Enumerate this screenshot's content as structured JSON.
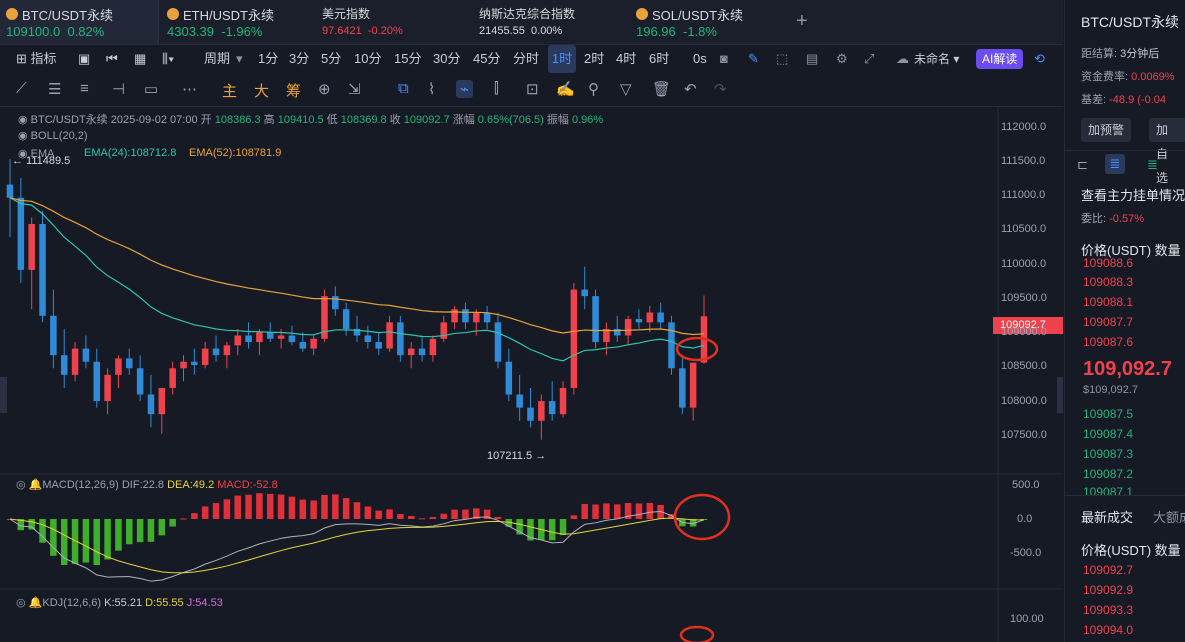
{
  "tabs": [
    {
      "name": "BTC/USDT永续",
      "price": "109100.0",
      "change": "0.82%",
      "dir": "up"
    },
    {
      "name": "ETH/USDT永续",
      "price": "4303.39",
      "change": "-1.96%",
      "dir": "up"
    },
    {
      "name": "美元指数",
      "price": "97.6421",
      "change": "-0.20%",
      "dir": "dn"
    },
    {
      "name": "纳斯达克综合指数",
      "price": "21455.55",
      "change": "0.00%",
      "dir": "neutral"
    },
    {
      "name": "SOL/USDT永续",
      "price": "196.96",
      "change": "-1.8%",
      "dir": "up"
    }
  ],
  "toolbar": {
    "indicator": "指标",
    "period": "周期",
    "intervals": [
      "1分",
      "3分",
      "5分",
      "10分",
      "15分",
      "30分",
      "45分",
      "分时",
      "1时",
      "2时",
      "4时",
      "6时",
      "0s"
    ],
    "selected_interval": "1时",
    "unnamed": "未命名",
    "ai": "AI解读"
  },
  "draw_tools": {
    "main": "主",
    "big": "大",
    "fund": "筹"
  },
  "chart": {
    "symbol": "BTC/USDT永续",
    "datetime": "2025-09-02 07:00",
    "open_label": "开",
    "open": "108386.3",
    "high_label": "高",
    "high": "109410.5",
    "low_label": "低",
    "low": "108369.8",
    "close_label": "收",
    "close": "109092.7",
    "change_label": "涨幅",
    "change": "0.65%(706.5)",
    "amp_label": "振幅",
    "amp": "0.96%",
    "boll": "BOLL(20,2)",
    "ema_label": "EMA",
    "ema24": "EMA(24):108712.8",
    "ema52": "EMA(52):108781.9",
    "high_mark": "← 111489.5",
    "low_mark": "107211.5 →",
    "price_tag": "109092.7",
    "y_ticks": [
      "112000.0",
      "111500.0",
      "111000.0",
      "110500.0",
      "110000.0",
      "109500.0",
      "109000.0",
      "108500.0",
      "108000.0",
      "107500.0"
    ],
    "macd": {
      "label": "MACD(12,26,9)",
      "dif": "DIF:22.8",
      "dea": "DEA:49.2",
      "macd": "MACD:-52.8",
      "ticks": [
        "500.0",
        "0.0",
        "-500.0"
      ]
    },
    "kdj": {
      "label": "KDJ(12,6,6)",
      "k": "K:55.21",
      "d": "D:55.55",
      "j": "J:54.53",
      "ticks": [
        "100.00"
      ]
    }
  },
  "chart_data": {
    "type": "candlestick",
    "interval": "1h",
    "ylim": [
      107100,
      112100
    ],
    "candles": [
      [
        111100,
        111489,
        110300,
        110900
      ],
      [
        110900,
        111200,
        109600,
        109800
      ],
      [
        109800,
        110600,
        109200,
        110500
      ],
      [
        110500,
        110700,
        109000,
        109100
      ],
      [
        109100,
        109500,
        108300,
        108500
      ],
      [
        108500,
        108900,
        108000,
        108200
      ],
      [
        108200,
        108700,
        108100,
        108600
      ],
      [
        108600,
        108800,
        108300,
        108400
      ],
      [
        108400,
        108600,
        107700,
        107800
      ],
      [
        107800,
        108300,
        107600,
        108200
      ],
      [
        108200,
        108500,
        108000,
        108450
      ],
      [
        108450,
        108600,
        108200,
        108300
      ],
      [
        108300,
        108500,
        107800,
        107900
      ],
      [
        107900,
        108200,
        107400,
        107600
      ],
      [
        107600,
        108000,
        107300,
        108000
      ],
      [
        108000,
        108400,
        107900,
        108300
      ],
      [
        108300,
        108500,
        108100,
        108400
      ],
      [
        108400,
        108600,
        108200,
        108350
      ],
      [
        108350,
        108700,
        108300,
        108600
      ],
      [
        108600,
        108800,
        108400,
        108500
      ],
      [
        108500,
        108700,
        108300,
        108650
      ],
      [
        108650,
        108900,
        108500,
        108800
      ],
      [
        108800,
        109000,
        108600,
        108700
      ],
      [
        108700,
        108900,
        108500,
        108850
      ],
      [
        108850,
        109000,
        108700,
        108750
      ],
      [
        108750,
        108900,
        108600,
        108800
      ],
      [
        108800,
        108950,
        108650,
        108700
      ],
      [
        108700,
        108850,
        108550,
        108600
      ],
      [
        108600,
        108800,
        108500,
        108750
      ],
      [
        108750,
        109500,
        108700,
        109400
      ],
      [
        109400,
        109550,
        109100,
        109200
      ],
      [
        109200,
        109300,
        108800,
        108900
      ],
      [
        108900,
        109100,
        108700,
        108800
      ],
      [
        108800,
        108950,
        108600,
        108700
      ],
      [
        108700,
        108850,
        108500,
        108600
      ],
      [
        108600,
        109100,
        108550,
        109000
      ],
      [
        109000,
        109100,
        108400,
        108500
      ],
      [
        108500,
        108700,
        108300,
        108600
      ],
      [
        108600,
        108800,
        108400,
        108500
      ],
      [
        108500,
        108800,
        108400,
        108750
      ],
      [
        108750,
        109100,
        108700,
        109000
      ],
      [
        109000,
        109250,
        108900,
        109200
      ],
      [
        109200,
        109300,
        108900,
        109000
      ],
      [
        109000,
        109200,
        108800,
        109150
      ],
      [
        109150,
        109250,
        108900,
        109000
      ],
      [
        109000,
        109150,
        108300,
        108400
      ],
      [
        108400,
        108600,
        107800,
        107900
      ],
      [
        107900,
        108200,
        107500,
        107700
      ],
      [
        107700,
        108000,
        107400,
        107500
      ],
      [
        107500,
        107900,
        107211,
        107800
      ],
      [
        107800,
        108100,
        107500,
        107600
      ],
      [
        107600,
        108100,
        107550,
        108000
      ],
      [
        108000,
        109600,
        107900,
        109500
      ],
      [
        109500,
        109850,
        109200,
        109400
      ],
      [
        109400,
        109500,
        108600,
        108700
      ],
      [
        108700,
        109000,
        108500,
        108900
      ],
      [
        108900,
        109100,
        108700,
        108800
      ],
      [
        108800,
        109100,
        108650,
        109050
      ],
      [
        109050,
        109200,
        108900,
        109000
      ],
      [
        109000,
        109250,
        108850,
        109150
      ],
      [
        109150,
        109300,
        108900,
        109000
      ],
      [
        109000,
        109100,
        108200,
        108300
      ],
      [
        108300,
        108500,
        107600,
        107700
      ],
      [
        107700,
        108386,
        107500,
        108386
      ],
      [
        108386,
        109410,
        108370,
        109093
      ]
    ]
  },
  "right_panel": {
    "title": "BTC/USDT永续",
    "settle_label": "距结算:",
    "settle": "3分钟后",
    "funding_label": "资金费率:",
    "funding": "0.0069%",
    "basis_label": "基差:",
    "basis": "-48.9 (-0.04",
    "alert_btn": "加预警",
    "watch_btn": "加自选",
    "orders_title": "查看主力挂单情况",
    "ratio_label": "委比:",
    "ratio": "-0.57%",
    "price_col": "价格(USDT)",
    "qty_col": "数量",
    "asks": [
      "109088.6",
      "109088.3",
      "109088.1",
      "109087.7",
      "109087.6"
    ],
    "last": "109,092.7",
    "last_sub": "$109,092.7",
    "bids": [
      "109087.5",
      "109087.4",
      "109087.3",
      "109087.2",
      "109087.1"
    ],
    "trades_tab": "最新成交",
    "big_tab": "大额成",
    "trades": [
      "109092.7",
      "109092.9",
      "109093.3",
      "109094.0"
    ]
  }
}
